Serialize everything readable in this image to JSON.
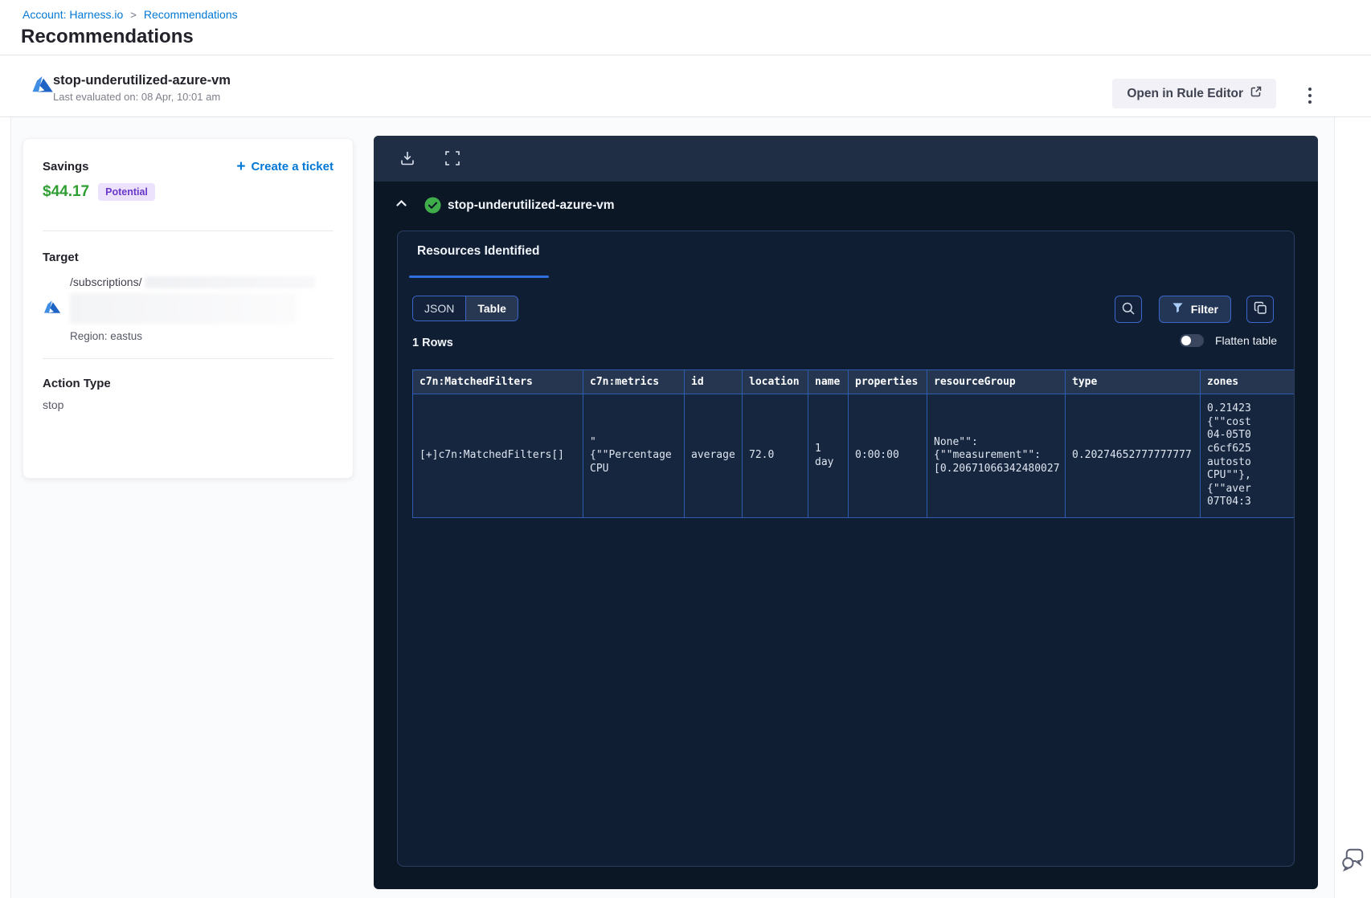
{
  "breadcrumb": {
    "account_link": "Account: Harness.io",
    "separator": ">",
    "current": "Recommendations"
  },
  "page_title": "Recommendations",
  "recommendation_header": {
    "title": "stop-underutilized-azure-vm",
    "last_evaluated": "Last evaluated on: 08 Apr, 10:01 am",
    "open_in_rule_editor_label": "Open in Rule Editor"
  },
  "details_card": {
    "savings_label": "Savings",
    "savings_amount": "$44.17",
    "savings_badge": "Potential",
    "create_ticket_plus": "+",
    "create_ticket_label": "Create a ticket",
    "target_label": "Target",
    "target_path": "/subscriptions/",
    "target_region": "Region: eastus",
    "action_type_label": "Action Type",
    "action_type_value": "stop"
  },
  "results_panel": {
    "title": "stop-underutilized-azure-vm",
    "tab_label": "Resources Identified",
    "view_toggle": {
      "json_label": "JSON",
      "table_label": "Table",
      "active": "Table"
    },
    "filter_label": "Filter",
    "rows_count": "1 Rows",
    "flatten_label": "Flatten table",
    "table": {
      "columns": [
        "c7n:MatchedFilters",
        "c7n:metrics",
        "id",
        "location",
        "name",
        "properties",
        "resourceGroup",
        "type",
        "zones"
      ],
      "cells": [
        "[+]c7n:MatchedFilters[]",
        "\"\n{\"\"Percentage\nCPU",
        "average",
        "72.0",
        "1\nday",
        "0:00:00",
        "None\"\":\n{\"\"measurement\"\":\n[0.20671066342480027",
        "0.20274652777777777",
        "0.21423\n{\"\"cost\n04-05T0\nc6cf625\nautosto\nCPU\"\"},\n{\"\"aver\n07T04:3"
      ]
    }
  },
  "colors": {
    "accent_blue": "#0278d5",
    "savings_green": "#2f9e33",
    "badge_purple_text": "#6938c7",
    "badge_purple_bg": "#ece2fd",
    "panel_bg": "#0c1726",
    "panel_accent_blue": "#2f6fe0",
    "table_border_blue": "#2d5cb0",
    "success_green": "#3fae4a",
    "link_cyan": "#7bcfe9"
  }
}
